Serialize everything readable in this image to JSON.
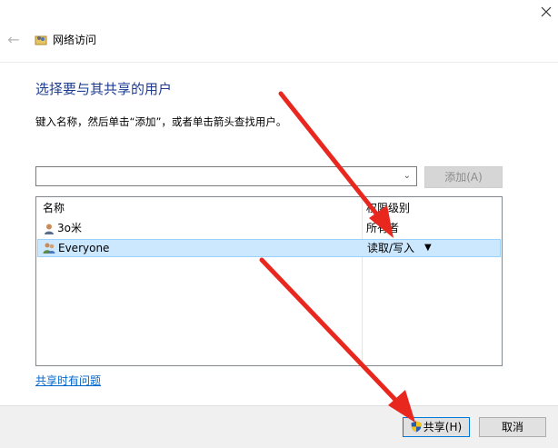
{
  "window": {
    "title": "网络访问",
    "back_glyph": "←",
    "close_glyph": "✕"
  },
  "main": {
    "heading": "选择要与其共享的用户",
    "instruction": "键入名称，然后单击“添加”，或者单击箭头查找用户。",
    "combo": {
      "value": "",
      "arrow": "⌄"
    },
    "add_button": "添加(A)"
  },
  "table": {
    "columns": [
      "名称",
      "权限级别"
    ],
    "rows": [
      {
        "name": "3o米",
        "permission": "所有者",
        "icon": "user-icon"
      },
      {
        "name": "Everyone",
        "permission": "读取/写入",
        "icon": "group-icon",
        "selected": true,
        "caret": "▼"
      }
    ]
  },
  "help_link": "共享时有问题",
  "footer": {
    "share_button": "共享(H)",
    "cancel_button": "取消"
  },
  "colors": {
    "heading": "#1e3d8f",
    "link": "#0066cc",
    "selection": "#cce8ff",
    "annotation_arrow": "#e8281f"
  }
}
